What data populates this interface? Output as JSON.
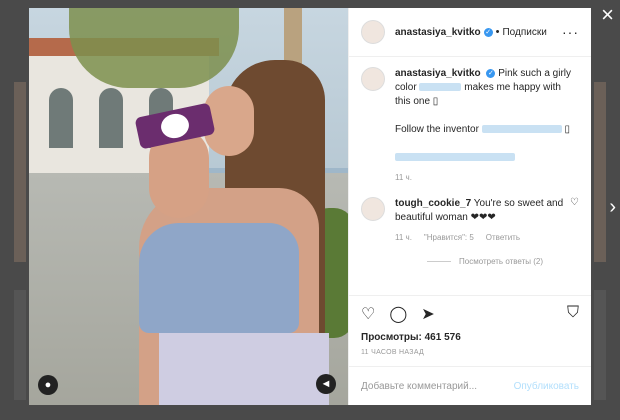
{
  "post": {
    "username": "anastasiya_kvitko",
    "follow_label": "Подписки",
    "caption": {
      "text_1": "Pink such a girly color",
      "text_2": "makes me happy with this one",
      "text_3": "Follow the inventor",
      "time": "11 ч."
    },
    "comment": {
      "username": "tough_cookie_7",
      "text": "You're so sweet and beautiful woman ❤❤❤",
      "time": "11 ч.",
      "likes": "\"Нравится\": 5",
      "reply_label": "Ответить",
      "view_replies": "Посмотреть ответы (2)"
    },
    "views": "Просмотры: 461 576",
    "posted_ago": "11 ЧАСОВ НАЗАД",
    "add_comment_placeholder": "Добавьте комментарий...",
    "publish_label": "Опубликовать"
  },
  "colors": {
    "link": "#3897f0",
    "publish_disabled": "#b2dffc"
  },
  "icons": [
    "heart-icon",
    "comment-icon",
    "share-icon",
    "bookmark-icon",
    "more-icon",
    "close-icon",
    "chevron-right-icon",
    "mute-icon",
    "user-tag-icon",
    "verified-icon"
  ]
}
